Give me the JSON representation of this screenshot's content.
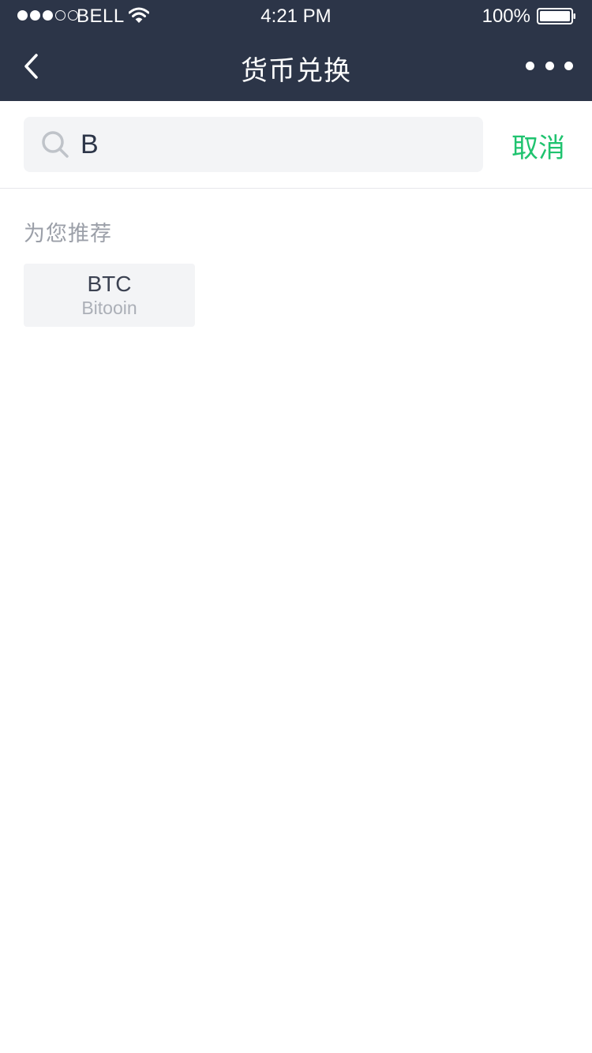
{
  "status_bar": {
    "signal_icon": "signal-dots-icon",
    "carrier": "BELL",
    "wifi_icon": "wifi-icon",
    "time": "4:21 PM",
    "battery_percent": "100%",
    "battery_icon": "battery-full-icon"
  },
  "nav": {
    "back_icon": "chevron-left-icon",
    "title": "货币兑换",
    "more_icon": "more-dots-icon"
  },
  "search": {
    "icon": "search-icon",
    "value": "B",
    "cancel_label": "取消"
  },
  "recommend": {
    "section_title": "为您推荐",
    "items": [
      {
        "code": "BTC",
        "name": "Bitooin"
      }
    ]
  },
  "colors": {
    "header_bg": "#2c3548",
    "accent_green": "#1fc36f",
    "search_bg": "#f3f4f6",
    "muted_text": "#9b9fa8"
  }
}
